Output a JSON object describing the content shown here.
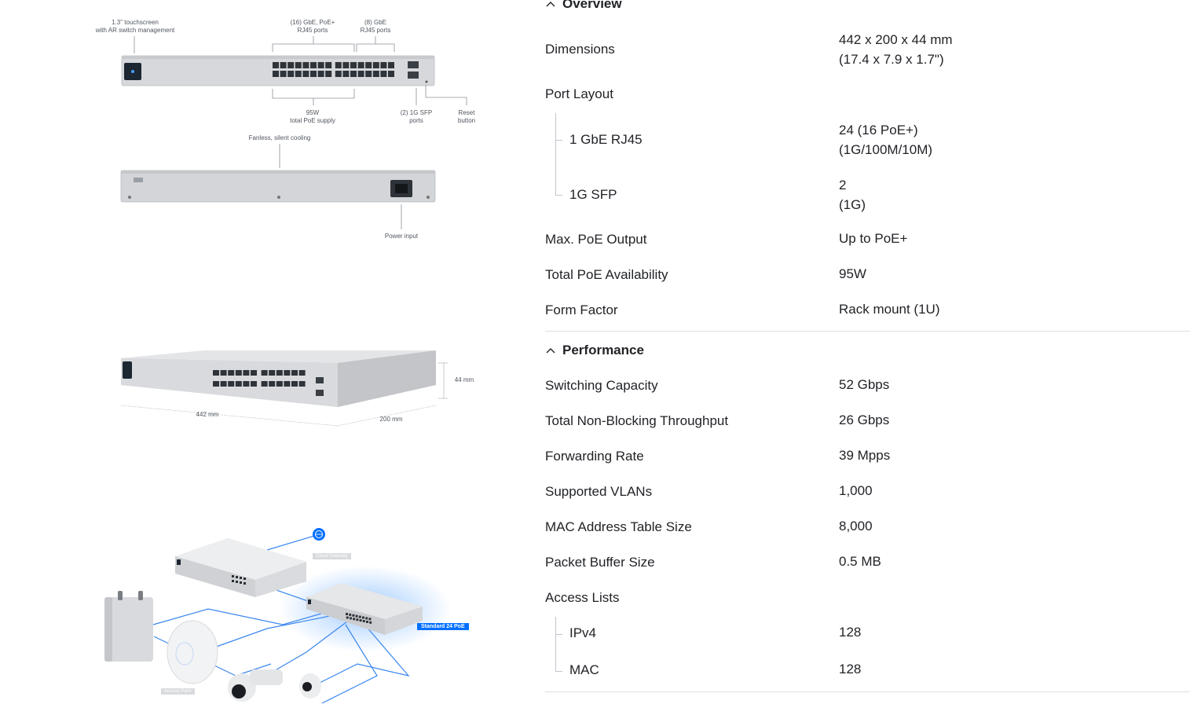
{
  "front_diagram": {
    "touchscreen": [
      "1.3\" touchscreen",
      "with AR switch management"
    ],
    "poe_ports": [
      "(16) GbE, PoE+",
      "RJ45 ports"
    ],
    "gbe_ports": [
      "(8) GbE",
      "RJ45 ports"
    ],
    "poe_supply": [
      "95W",
      "total PoE supply"
    ],
    "sfp_ports": [
      "(2) 1G SFP",
      "ports"
    ],
    "reset": [
      "Reset",
      "button"
    ],
    "cooling": "Fanless, silent cooling",
    "power": "Power input"
  },
  "dimension_diagram": {
    "width": "442 mm",
    "depth": "200 mm",
    "height": "44 mm"
  },
  "topology": {
    "cloud_gateway": "Cloud Gateway",
    "standard_switch": "Standard 24 PoE",
    "access_point": "Access Point"
  },
  "overview": {
    "title": "Overview",
    "dimensions_label": "Dimensions",
    "dimensions_value": [
      "442 x 200 x 44 mm",
      "(17.4 x 7.9 x 1.7\")"
    ],
    "port_layout_label": "Port Layout",
    "rj45_label": "1 GbE RJ45",
    "rj45_value": [
      "24 (16 PoE+)",
      "(1G/100M/10M)"
    ],
    "sfp_label": "1G SFP",
    "sfp_value": [
      "2",
      "(1G)"
    ],
    "poe_output_label": "Max. PoE Output",
    "poe_output_value": "Up to PoE+",
    "poe_avail_label": "Total PoE Availability",
    "poe_avail_value": "95W",
    "form_factor_label": "Form Factor",
    "form_factor_value": "Rack mount (1U)"
  },
  "performance": {
    "title": "Performance",
    "rows": [
      {
        "label": "Switching Capacity",
        "value": "52 Gbps"
      },
      {
        "label": "Total Non-Blocking Throughput",
        "value": "26 Gbps"
      },
      {
        "label": "Forwarding Rate",
        "value": "39 Mpps"
      },
      {
        "label": "Supported VLANs",
        "value": "1,000"
      },
      {
        "label": "MAC Address Table Size",
        "value": "8,000"
      },
      {
        "label": "Packet Buffer Size",
        "value": "0.5 MB"
      }
    ],
    "access_lists_label": "Access Lists",
    "ipv4_label": "IPv4",
    "ipv4_value": "128",
    "mac_label": "MAC",
    "mac_value": "128"
  },
  "colors": {
    "text": "#212327",
    "accent": "#006fff",
    "divider": "#dcdee2",
    "switch_body": "#d4d6d9"
  },
  "icons": [
    "chevron-up-icon",
    "globe-icon"
  ]
}
